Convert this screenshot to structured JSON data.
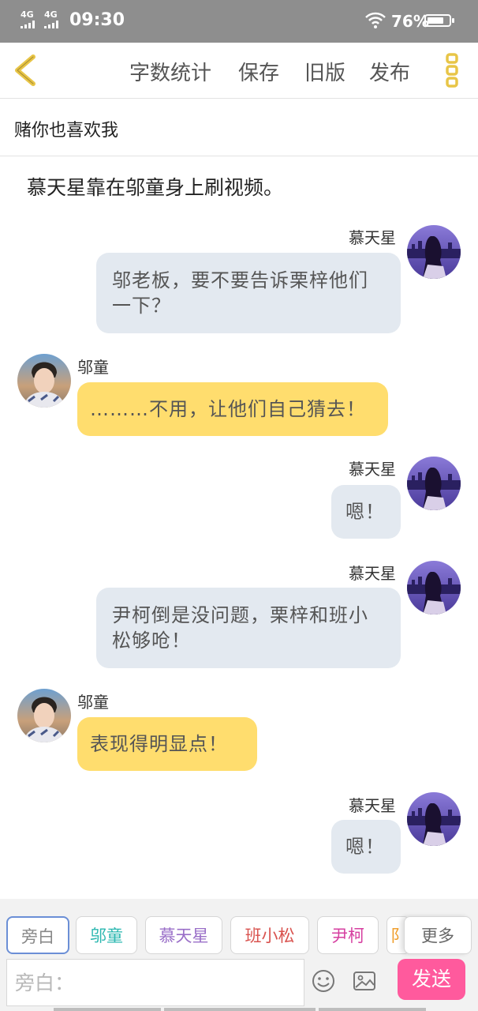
{
  "status_bar": {
    "network_1": "4G",
    "network_2": "4G",
    "time": "09:30",
    "battery_pct_text": "76%",
    "battery_level": 0.76
  },
  "toolbar": {
    "back_icon": "chevron-left-icon",
    "items": [
      "字数统计",
      "保存",
      "旧版",
      "发布"
    ],
    "more_icon": "vertical-dots-icon",
    "accent_color": "#e8c547"
  },
  "chapter_title": "赌你也喜欢我",
  "narration": "慕天星靠在邬童身上刷视频。",
  "messages": [
    {
      "side": "right",
      "name": "慕天星",
      "text": "邬老板，要不要告诉栗梓他们一下？"
    },
    {
      "side": "left",
      "name": "邬童",
      "text": "………不用，让他们自己猜去！"
    },
    {
      "side": "right",
      "name": "慕天星",
      "text": "嗯！"
    },
    {
      "side": "right",
      "name": "慕天星",
      "text": "尹柯倒是没问题，栗梓和班小松够呛！"
    },
    {
      "side": "left",
      "name": "邬童",
      "text": "表现得明显点！"
    },
    {
      "side": "right",
      "name": "慕天星",
      "text": "嗯！"
    }
  ],
  "role_chips": [
    {
      "label": "旁白",
      "color": "#888888",
      "active": true
    },
    {
      "label": "邬童",
      "color": "#2bb7b0",
      "active": false
    },
    {
      "label": "慕天星",
      "color": "#9a6fc8",
      "active": false
    },
    {
      "label": "班小松",
      "color": "#d9534f",
      "active": false
    },
    {
      "label": "尹柯",
      "color": "#d63fa0",
      "active": false
    },
    {
      "label": "阝",
      "color": "#f0a030",
      "active": false
    }
  ],
  "more_label": "更多",
  "input": {
    "placeholder": "旁白：",
    "value": ""
  },
  "emoji_icon": "emoji-icon",
  "image_icon": "image-icon",
  "send_label": "发送",
  "colors": {
    "send": "#ff5a9d",
    "left_bubble": "#ffdd6e",
    "right_bubble": "#e3e9f0"
  }
}
